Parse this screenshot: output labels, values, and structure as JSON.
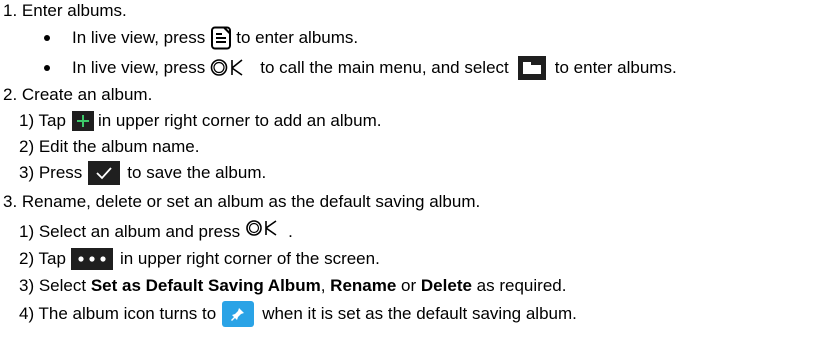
{
  "step1": {
    "heading": "1. Enter albums.",
    "bullet1": {
      "before": "In live view, press",
      "after": "to enter albums.",
      "icon": "albums-icon"
    },
    "bullet2": {
      "before": "In live view, press",
      "ok_text": "OK",
      "middle": "to call the main menu, and select",
      "after": "to enter albums.",
      "icon": "folder-icon"
    }
  },
  "step2": {
    "heading": "2. Create an album.",
    "sub1": {
      "before": "1) Tap",
      "after": "in upper right corner to add an album.",
      "icon": "plus-icon"
    },
    "sub2": {
      "text": "2) Edit the album name."
    },
    "sub3": {
      "before": "3) Press",
      "after": "to save the album.",
      "icon": "check-icon"
    }
  },
  "step3": {
    "heading": "3. Rename, delete or set an album as the default saving album.",
    "sub1": {
      "before": "1) Select an album and press",
      "ok_text": "OK",
      "after": "."
    },
    "sub2": {
      "before": "2) Tap",
      "after": "in upper right corner of the screen.",
      "icon": "more-icon"
    },
    "sub3": {
      "prefix": "3) Select",
      "bold1": "Set as Default Saving Album",
      "sep1": ",",
      "bold2": "Rename",
      "sep2": "or",
      "bold3": "Delete",
      "suffix": "as required."
    },
    "sub4": {
      "before": "4) The album icon turns to",
      "after": "when it is set as the default saving album.",
      "icon": "pin-icon"
    }
  },
  "colors": {
    "icon_dark": "#1f1f1f",
    "pin_blue": "#2aa3e6",
    "plus_green": "#3dc96a"
  }
}
